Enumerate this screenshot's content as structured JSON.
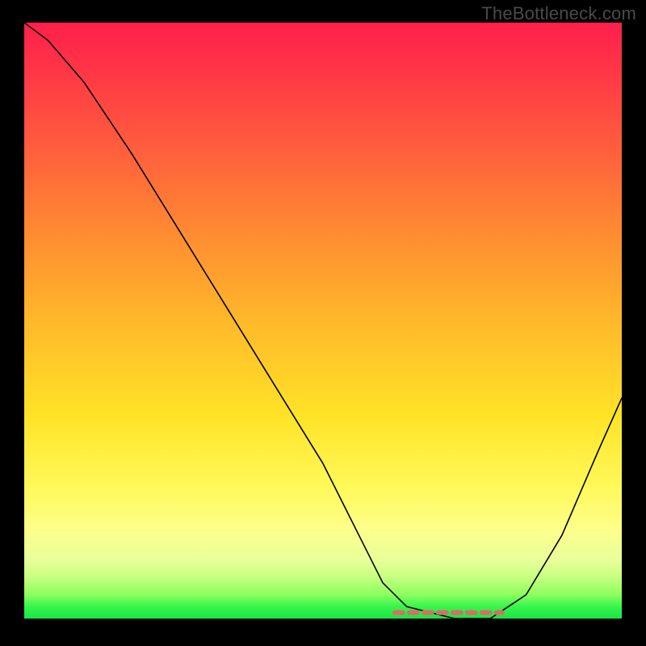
{
  "watermark": "TheBottleneck.com",
  "chart_data": {
    "type": "line",
    "title": "",
    "xlabel": "",
    "ylabel": "",
    "xlim": [
      0,
      100
    ],
    "ylim": [
      0,
      100
    ],
    "grid": false,
    "series": [
      {
        "name": "bottleneck-curve",
        "x": [
          0,
          4,
          10,
          18,
          26,
          34,
          42,
          50,
          56,
          60,
          64,
          72,
          78,
          84,
          90,
          96,
          100
        ],
        "y": [
          100,
          97,
          90,
          78,
          65,
          52,
          39,
          26,
          14,
          6,
          2,
          0,
          0,
          4,
          14,
          28,
          37
        ]
      }
    ],
    "annotations": [
      {
        "name": "optimal-flat-region",
        "x_start": 62,
        "x_end": 80,
        "y": 1
      }
    ],
    "background_gradient": {
      "top_color": "#ff1f4b",
      "mid_color": "#fff95a",
      "bottom_color": "#16e746"
    }
  }
}
